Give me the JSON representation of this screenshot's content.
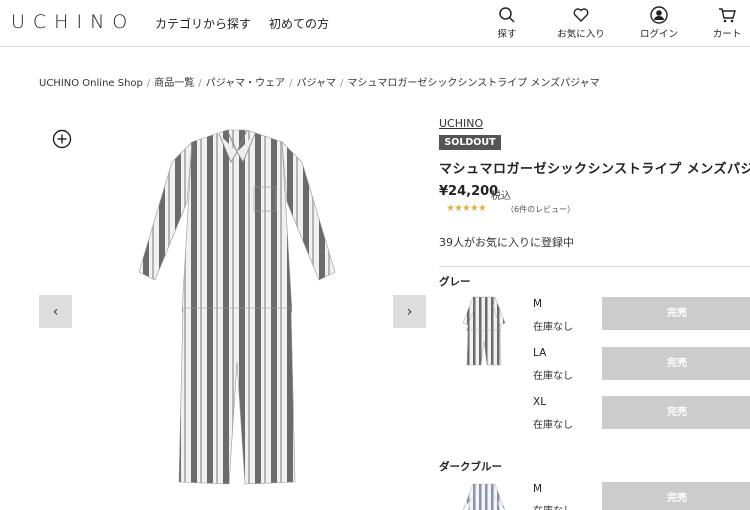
{
  "header": {
    "logo": "UCHINO",
    "nav": [
      "カテゴリから探す",
      "初めての方"
    ],
    "actions": [
      {
        "label": "探す",
        "icon": "search-icon"
      },
      {
        "label": "お気に入り",
        "icon": "heart-icon"
      },
      {
        "label": "ログイン",
        "icon": "user-icon"
      },
      {
        "label": "カート",
        "icon": "cart-icon"
      }
    ]
  },
  "breadcrumb": [
    "UCHINO Online Shop",
    "商品一覧",
    "パジャマ・ウェア",
    "パジャマ",
    "マシュマロガーゼシックシンストライプ メンズパジャマ"
  ],
  "gallery": {
    "prev_label": "‹",
    "next_label": "›"
  },
  "product": {
    "brand": "UCHINO",
    "badge": "SOLDOUT",
    "title": "マシュマロガーゼシックシンストライプ メンズパジャマ",
    "price": "¥24,200",
    "tax": "税込",
    "stars": "★★★★★",
    "rating": 5,
    "reviews": "（6件のレビュー）",
    "favorites": "39人がお気に入りに登録中"
  },
  "variants": [
    {
      "color": "グレー",
      "sizes": [
        {
          "size": "M",
          "stock": "在庫なし",
          "button": "完売"
        },
        {
          "size": "LA",
          "stock": "在庫なし",
          "button": "完売"
        },
        {
          "size": "XL",
          "stock": "在庫なし",
          "button": "完売"
        }
      ]
    },
    {
      "color": "ダークブルー",
      "sizes": [
        {
          "size": "M",
          "stock": "在庫なし",
          "button": "完売"
        }
      ]
    }
  ],
  "colors": {
    "stripe_dark": "#6b6b6b",
    "stripe_light": "#f1f1f1",
    "star": "#e2b24a",
    "soldout_bg": "#555555",
    "sold_button": "#cccccc"
  }
}
